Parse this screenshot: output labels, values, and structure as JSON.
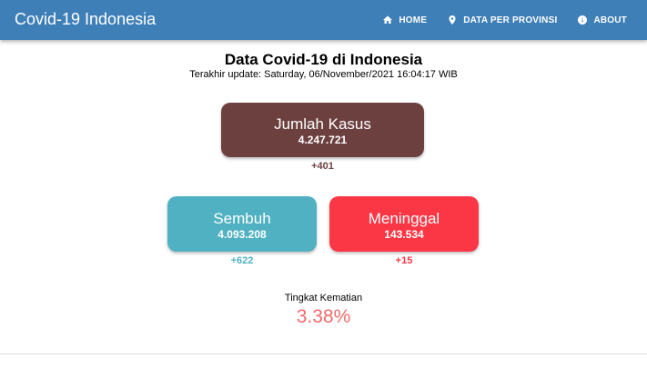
{
  "app": {
    "title": "Covid-19 Indonesia",
    "nav": [
      {
        "label": "HOME",
        "icon": "home-icon"
      },
      {
        "label": "DATA PER PROVINSI",
        "icon": "location-pin-icon"
      },
      {
        "label": "ABOUT",
        "icon": "info-icon"
      }
    ]
  },
  "main": {
    "title": "Data Covid-19 di Indonesia",
    "updated": "Terakhir update: Saturday, 06/November/2021 16:04:17 WIB",
    "cases": {
      "label": "Jumlah Kasus",
      "value": "4.247.721",
      "delta": "+401"
    },
    "recovered": {
      "label": "Sembuh",
      "value": "4.093.208",
      "delta": "+622"
    },
    "deaths": {
      "label": "Meninggal",
      "value": "143.534",
      "delta": "+15"
    },
    "fatality": {
      "label": "Tingkat Kematian",
      "value": "3.38%"
    }
  },
  "colors": {
    "appbar": "#3f7fb8",
    "cases": "#6d4040",
    "recovered": "#4fb1c1",
    "deaths": "#fc3745",
    "fatality": "#f06a6a"
  }
}
